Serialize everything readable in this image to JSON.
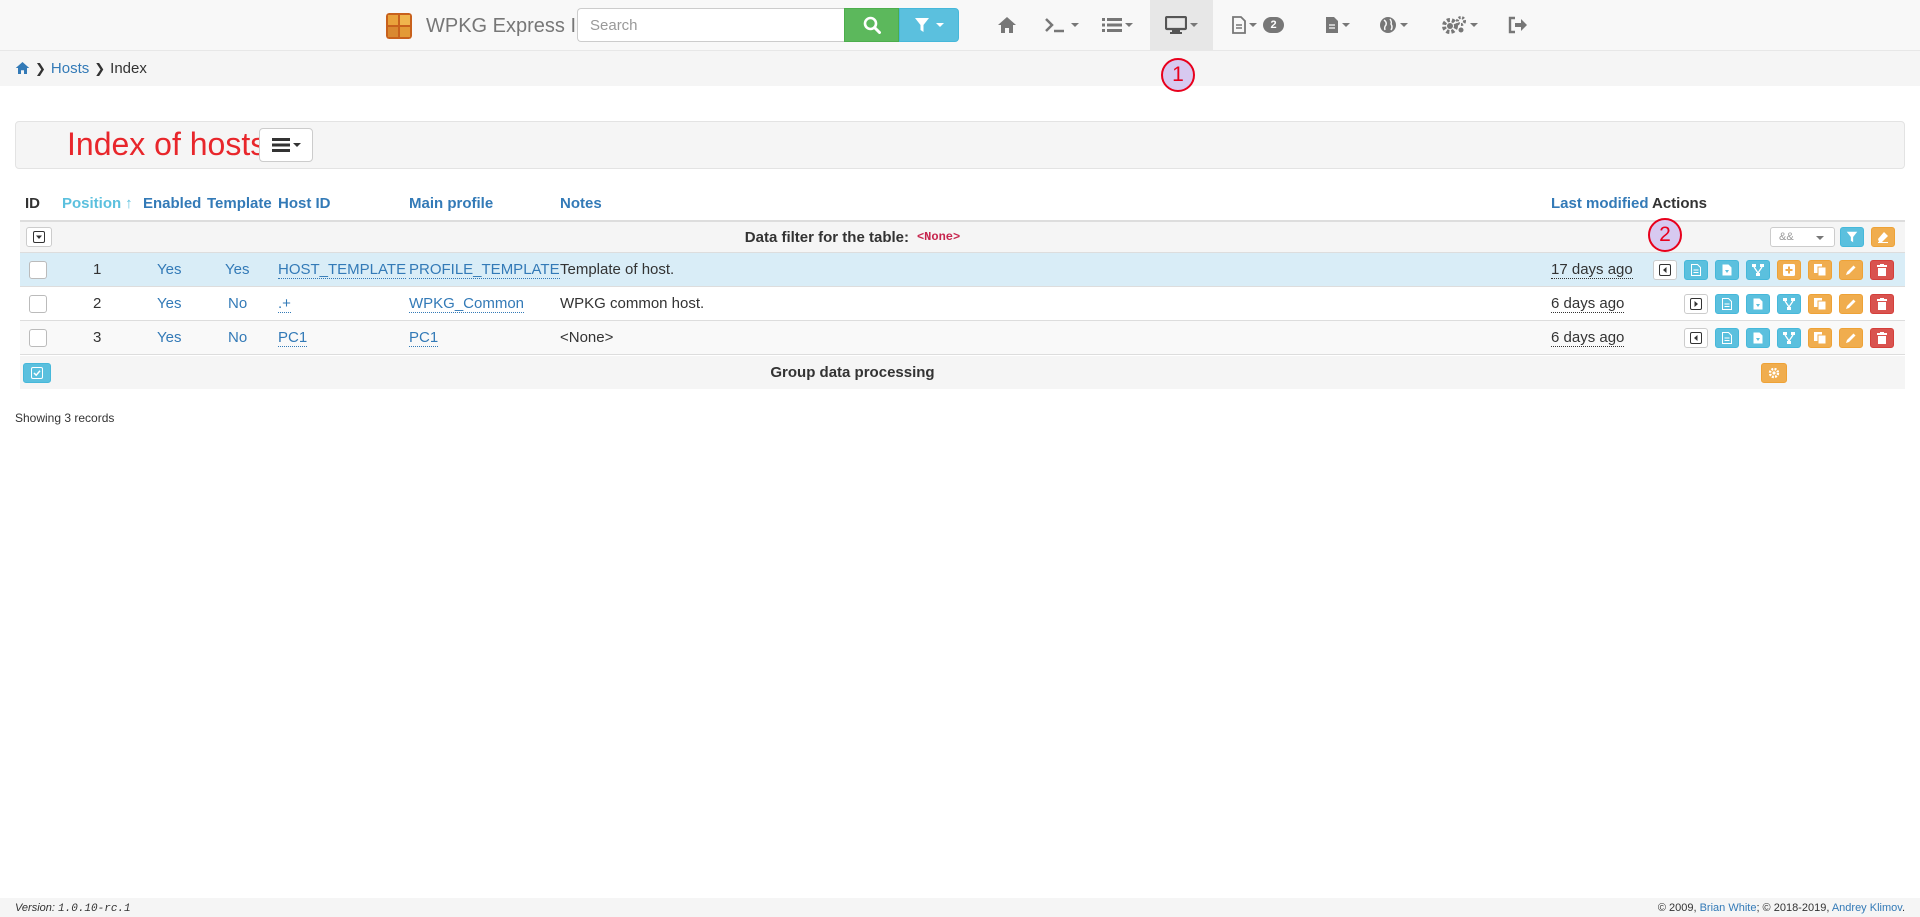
{
  "navbar": {
    "brand": "WPKG Express II",
    "search_placeholder": "Search",
    "badge_count": "2",
    "items": [
      "home-icon",
      "console-icon",
      "list-icon",
      "desktop-icon",
      "file-icon",
      "file-text-icon",
      "globe-icon",
      "cogs-icon",
      "logout-icon"
    ],
    "active_item": "desktop-icon"
  },
  "breadcrumb": {
    "root_icon": "home-icon",
    "items": [
      "Hosts",
      "Index"
    ]
  },
  "markers": {
    "m1": "1",
    "m2": "2"
  },
  "header": {
    "title": "Index of hosts",
    "menu_icon": "bars-icon"
  },
  "table": {
    "columns": {
      "id": "ID",
      "position": "Position",
      "enabled": "Enabled",
      "template": "Template",
      "host_id": "Host ID",
      "main_profile": "Main profile",
      "notes": "Notes",
      "last_modified": "Last modified",
      "actions": "Actions"
    },
    "sort_icon": "sort-up-icon",
    "filter": {
      "label": "Data filter for the table:",
      "value": "<None>",
      "logic": "&&"
    },
    "rows": [
      {
        "position": "1",
        "enabled": "Yes",
        "template": "Yes",
        "host_id": "HOST_TEMPLATE",
        "main_profile": "PROFILE_TEMPLATE",
        "notes": "Template of host.",
        "last_modified": "17 days ago"
      },
      {
        "position": "2",
        "enabled": "Yes",
        "template": "No",
        "host_id": ".+",
        "main_profile": "WPKG_Common",
        "notes": "WPKG common host.",
        "last_modified": "6 days ago"
      },
      {
        "position": "3",
        "enabled": "Yes",
        "template": "No",
        "host_id": "PC1",
        "main_profile": "PC1",
        "notes": "<None>",
        "last_modified": "6 days ago"
      }
    ],
    "group_label": "Group data processing"
  },
  "records_text": "Showing 3 records",
  "footer": {
    "version_label": "Version:",
    "version": "1.0.10-rc.1",
    "copy_1": "© 2009,",
    "author_1": "Brian White",
    "copy_2": "; © 2018-2019,",
    "author_2": "Andrey Klimov",
    "end": "."
  },
  "colors": {
    "primary": "#337ab7",
    "info": "#5bc0de",
    "success": "#5cb85c",
    "warning": "#f0ad4e",
    "danger": "#d9534f",
    "title": "#e8262b",
    "row_highlight": "#d9edf7"
  }
}
